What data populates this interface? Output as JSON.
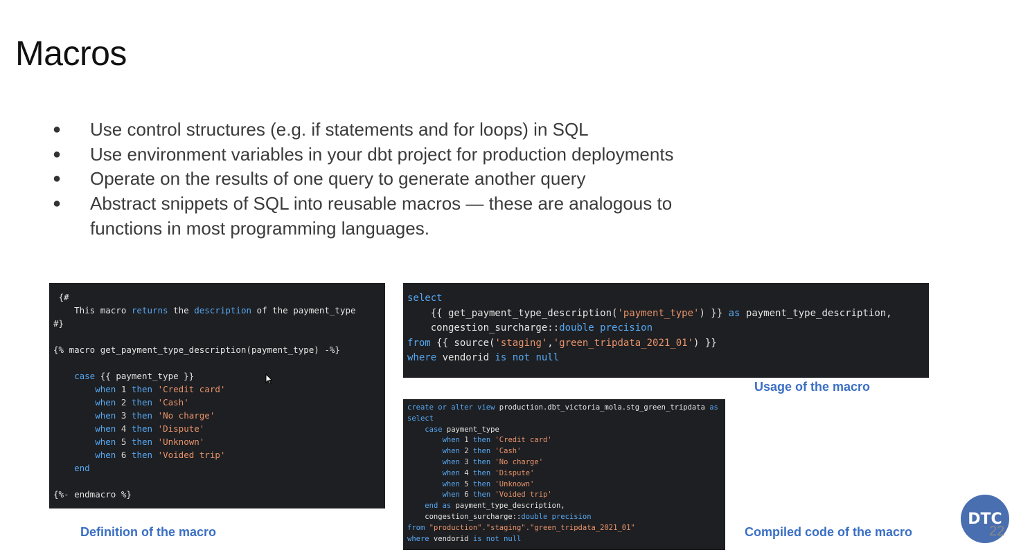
{
  "slide": {
    "title": "Macros",
    "bullets": [
      "Use control structures (e.g. if statements and for loops) in SQL",
      "Use environment variables in your dbt project for production deployments",
      "Operate on the results of one query to generate another query",
      "Abstract snippets of SQL into reusable macros — these are analogous to functions in most programming languages."
    ],
    "bullet_symbol": "●",
    "page_number": "22",
    "logo_text": "DTC"
  },
  "captions": {
    "definition": "Definition of the macro",
    "usage": "Usage of the macro",
    "compiled": "Compiled code of the macro"
  },
  "code": {
    "definition": [
      [
        {
          "t": " {#"
        }
      ],
      [
        {
          "t": "    This macro "
        },
        {
          "t": "returns",
          "c": "kw"
        },
        {
          "t": " the "
        },
        {
          "t": "description",
          "c": "kw"
        },
        {
          "t": " of the payment_type"
        }
      ],
      [
        {
          "t": "#}"
        }
      ],
      [
        {
          "t": ""
        }
      ],
      [
        {
          "t": "{% macro get_payment_type_description(payment_type) -%}"
        }
      ],
      [
        {
          "t": ""
        }
      ],
      [
        {
          "t": "    "
        },
        {
          "t": "case",
          "c": "kw"
        },
        {
          "t": " {{ payment_type }}"
        }
      ],
      [
        {
          "t": "        "
        },
        {
          "t": "when",
          "c": "kw"
        },
        {
          "t": " "
        },
        {
          "t": "1",
          "c": "num"
        },
        {
          "t": " "
        },
        {
          "t": "then",
          "c": "kw"
        },
        {
          "t": " "
        },
        {
          "t": "'Credit card'",
          "c": "str"
        }
      ],
      [
        {
          "t": "        "
        },
        {
          "t": "when",
          "c": "kw"
        },
        {
          "t": " "
        },
        {
          "t": "2",
          "c": "num"
        },
        {
          "t": " "
        },
        {
          "t": "then",
          "c": "kw"
        },
        {
          "t": " "
        },
        {
          "t": "'Cash'",
          "c": "str"
        }
      ],
      [
        {
          "t": "        "
        },
        {
          "t": "when",
          "c": "kw"
        },
        {
          "t": " "
        },
        {
          "t": "3",
          "c": "num"
        },
        {
          "t": " "
        },
        {
          "t": "then",
          "c": "kw"
        },
        {
          "t": " "
        },
        {
          "t": "'No charge'",
          "c": "str"
        }
      ],
      [
        {
          "t": "        "
        },
        {
          "t": "when",
          "c": "kw"
        },
        {
          "t": " "
        },
        {
          "t": "4",
          "c": "num"
        },
        {
          "t": " "
        },
        {
          "t": "then",
          "c": "kw"
        },
        {
          "t": " "
        },
        {
          "t": "'Dispute'",
          "c": "str"
        }
      ],
      [
        {
          "t": "        "
        },
        {
          "t": "when",
          "c": "kw"
        },
        {
          "t": " "
        },
        {
          "t": "5",
          "c": "num"
        },
        {
          "t": " "
        },
        {
          "t": "then",
          "c": "kw"
        },
        {
          "t": " "
        },
        {
          "t": "'Unknown'",
          "c": "str"
        }
      ],
      [
        {
          "t": "        "
        },
        {
          "t": "when",
          "c": "kw"
        },
        {
          "t": " "
        },
        {
          "t": "6",
          "c": "num"
        },
        {
          "t": " "
        },
        {
          "t": "then",
          "c": "kw"
        },
        {
          "t": " "
        },
        {
          "t": "'Voided trip'",
          "c": "str"
        }
      ],
      [
        {
          "t": "    "
        },
        {
          "t": "end",
          "c": "kw"
        }
      ],
      [
        {
          "t": ""
        }
      ],
      [
        {
          "t": "{%- endmacro %}"
        }
      ]
    ],
    "usage": [
      [
        {
          "t": "select",
          "c": "kw"
        }
      ],
      [
        {
          "t": "    {{ get_payment_type_description("
        },
        {
          "t": "'payment_type'",
          "c": "str"
        },
        {
          "t": ") }} "
        },
        {
          "t": "as",
          "c": "kw"
        },
        {
          "t": " payment_type_description,"
        }
      ],
      [
        {
          "t": "    congestion_surcharge::"
        },
        {
          "t": "double precision",
          "c": "kw"
        }
      ],
      [
        {
          "t": "from",
          "c": "kw"
        },
        {
          "t": " {{ source("
        },
        {
          "t": "'staging'",
          "c": "str"
        },
        {
          "t": ","
        },
        {
          "t": "'green_tripdata_2021_01'",
          "c": "str"
        },
        {
          "t": ") }}"
        }
      ],
      [
        {
          "t": "where",
          "c": "kw"
        },
        {
          "t": " vendorid "
        },
        {
          "t": "is not null",
          "c": "kw"
        }
      ]
    ],
    "compiled": [
      [
        {
          "t": "create or alter",
          "c": "kw"
        },
        {
          "t": " "
        },
        {
          "t": "view",
          "c": "kw"
        },
        {
          "t": " production.dbt_victoria_mola.stg_green_tripdata "
        },
        {
          "t": "as",
          "c": "kw"
        }
      ],
      [
        {
          "t": "select",
          "c": "kw"
        }
      ],
      [
        {
          "t": "    "
        },
        {
          "t": "case",
          "c": "kw"
        },
        {
          "t": " payment_type"
        }
      ],
      [
        {
          "t": "        "
        },
        {
          "t": "when",
          "c": "kw"
        },
        {
          "t": " "
        },
        {
          "t": "1",
          "c": "num"
        },
        {
          "t": " "
        },
        {
          "t": "then",
          "c": "kw"
        },
        {
          "t": " "
        },
        {
          "t": "'Credit card'",
          "c": "str"
        }
      ],
      [
        {
          "t": "        "
        },
        {
          "t": "when",
          "c": "kw"
        },
        {
          "t": " "
        },
        {
          "t": "2",
          "c": "num"
        },
        {
          "t": " "
        },
        {
          "t": "then",
          "c": "kw"
        },
        {
          "t": " "
        },
        {
          "t": "'Cash'",
          "c": "str"
        }
      ],
      [
        {
          "t": "        "
        },
        {
          "t": "when",
          "c": "kw"
        },
        {
          "t": " "
        },
        {
          "t": "3",
          "c": "num"
        },
        {
          "t": " "
        },
        {
          "t": "then",
          "c": "kw"
        },
        {
          "t": " "
        },
        {
          "t": "'No charge'",
          "c": "str"
        }
      ],
      [
        {
          "t": "        "
        },
        {
          "t": "when",
          "c": "kw"
        },
        {
          "t": " "
        },
        {
          "t": "4",
          "c": "num"
        },
        {
          "t": " "
        },
        {
          "t": "then",
          "c": "kw"
        },
        {
          "t": " "
        },
        {
          "t": "'Dispute'",
          "c": "str"
        }
      ],
      [
        {
          "t": "        "
        },
        {
          "t": "when",
          "c": "kw"
        },
        {
          "t": " "
        },
        {
          "t": "5",
          "c": "num"
        },
        {
          "t": " "
        },
        {
          "t": "then",
          "c": "kw"
        },
        {
          "t": " "
        },
        {
          "t": "'Unknown'",
          "c": "str"
        }
      ],
      [
        {
          "t": "        "
        },
        {
          "t": "when",
          "c": "kw"
        },
        {
          "t": " "
        },
        {
          "t": "6",
          "c": "num"
        },
        {
          "t": " "
        },
        {
          "t": "then",
          "c": "kw"
        },
        {
          "t": " "
        },
        {
          "t": "'Voided trip'",
          "c": "str"
        }
      ],
      [
        {
          "t": "    "
        },
        {
          "t": "end",
          "c": "kw"
        },
        {
          "t": " "
        },
        {
          "t": "as",
          "c": "kw"
        },
        {
          "t": " payment_type_description,"
        }
      ],
      [
        {
          "t": "    congestion_surcharge::"
        },
        {
          "t": "double precision",
          "c": "kw"
        }
      ],
      [
        {
          "t": "from",
          "c": "kw"
        },
        {
          "t": " "
        },
        {
          "t": "\"production\".\"staging\".\"green_tripdata_2021_01\"",
          "c": "str"
        }
      ],
      [
        {
          "t": "where",
          "c": "kw"
        },
        {
          "t": " vendorid "
        },
        {
          "t": "is not null",
          "c": "kw"
        }
      ]
    ]
  },
  "colors": {
    "code_background": "#1e1f22",
    "keyword": "#55a7f2",
    "string": "#e8936a",
    "caption": "#3a6fc4",
    "logo": "#4a6fb0"
  },
  "icons": {
    "cursor": "mouse-pointer-icon",
    "logo": "dtc-logo-icon"
  }
}
